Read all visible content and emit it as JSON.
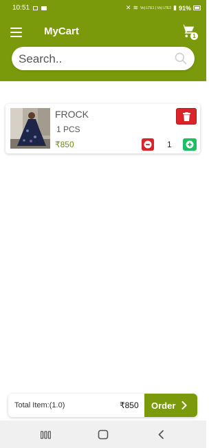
{
  "status_bar": {
    "time": "10:51",
    "battery": "91%",
    "network": "Vo) LTE1 | Vo) LTE2"
  },
  "header": {
    "title": "MyCart",
    "cart_badge_count": "1"
  },
  "search": {
    "placeholder": "Search.."
  },
  "cart_item": {
    "name": "FROCK",
    "quantity_text": "1 PCS",
    "price": "₹850",
    "quantity": "1"
  },
  "footer": {
    "total_label": "Total Item:(1.0)",
    "total_amount": "₹850",
    "order_label": "Order"
  },
  "colors": {
    "brand_green": "#7a9a0b",
    "delete_red": "#d9252a",
    "plus_green": "#1dbf63",
    "price_green": "#6d8f00"
  },
  "icons": [
    "menu-icon",
    "cart-icon",
    "search-icon",
    "trash-icon",
    "minus-icon",
    "plus-icon",
    "chevron-right-icon",
    "recents-icon",
    "home-icon",
    "back-icon"
  ]
}
